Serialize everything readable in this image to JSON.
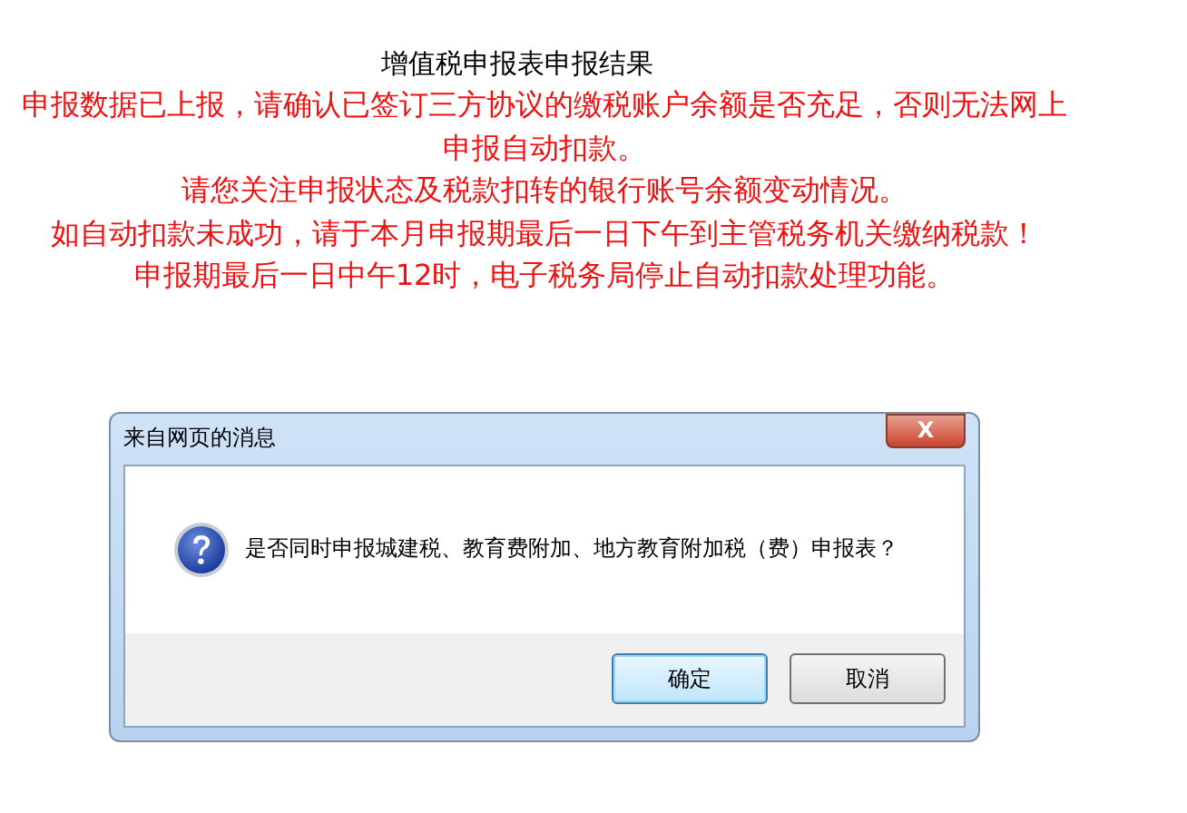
{
  "page": {
    "title": "增值税申报表申报结果",
    "notices": [
      "申报数据已上报，请确认已签订三方协议的缴税账户余额是否充足，否则无法网上申报自动扣款。",
      "请您关注申报状态及税款扣转的银行账号余额变动情况。",
      "如自动扣款未成功，请于本月申报期最后一日下午到主管税务机关缴纳税款！",
      "申报期最后一日中午12时，电子税务局停止自动扣款处理功能。"
    ]
  },
  "dialog": {
    "title": "来自网页的消息",
    "close": "X",
    "message": "是否同时申报城建税、教育费附加、地方教育附加税（费）申报表？",
    "buttons": [
      {
        "label": "确定",
        "selected": true
      },
      {
        "label": "取消",
        "selected": false
      }
    ]
  }
}
